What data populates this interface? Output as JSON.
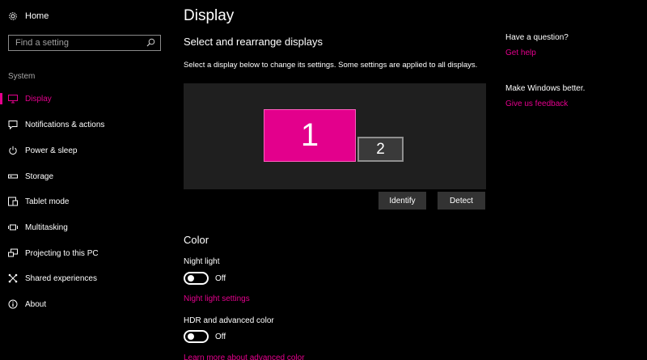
{
  "sidebar": {
    "home_label": "Home",
    "search_placeholder": "Find a setting",
    "section_label": "System",
    "items": [
      {
        "label": "Display",
        "icon": "monitor-icon",
        "active": true
      },
      {
        "label": "Notifications & actions",
        "icon": "message-icon"
      },
      {
        "label": "Power & sleep",
        "icon": "power-icon"
      },
      {
        "label": "Storage",
        "icon": "storage-icon"
      },
      {
        "label": "Tablet mode",
        "icon": "tablet-icon"
      },
      {
        "label": "Multitasking",
        "icon": "multitask-icon"
      },
      {
        "label": "Projecting to this PC",
        "icon": "project-icon"
      },
      {
        "label": "Shared experiences",
        "icon": "shared-icon"
      },
      {
        "label": "About",
        "icon": "info-icon"
      }
    ]
  },
  "main": {
    "title": "Display",
    "subtitle": "Select and rearrange displays",
    "description": "Select a display below to change its settings. Some settings are applied to all displays.",
    "monitors": [
      {
        "label": "1"
      },
      {
        "label": "2"
      }
    ],
    "identify_label": "Identify",
    "detect_label": "Detect",
    "color_heading": "Color",
    "night_light_label": "Night light",
    "night_light_state": "Off",
    "night_light_settings_link": "Night light settings",
    "hdr_label": "HDR and advanced color",
    "hdr_state": "Off",
    "hdr_link": "Learn more about advanced color"
  },
  "right": {
    "question_heading": "Have a question?",
    "help_link": "Get help",
    "better_heading": "Make Windows better.",
    "feedback_link": "Give us feedback"
  },
  "colors": {
    "accent": "#e3008c",
    "background": "#000000"
  }
}
